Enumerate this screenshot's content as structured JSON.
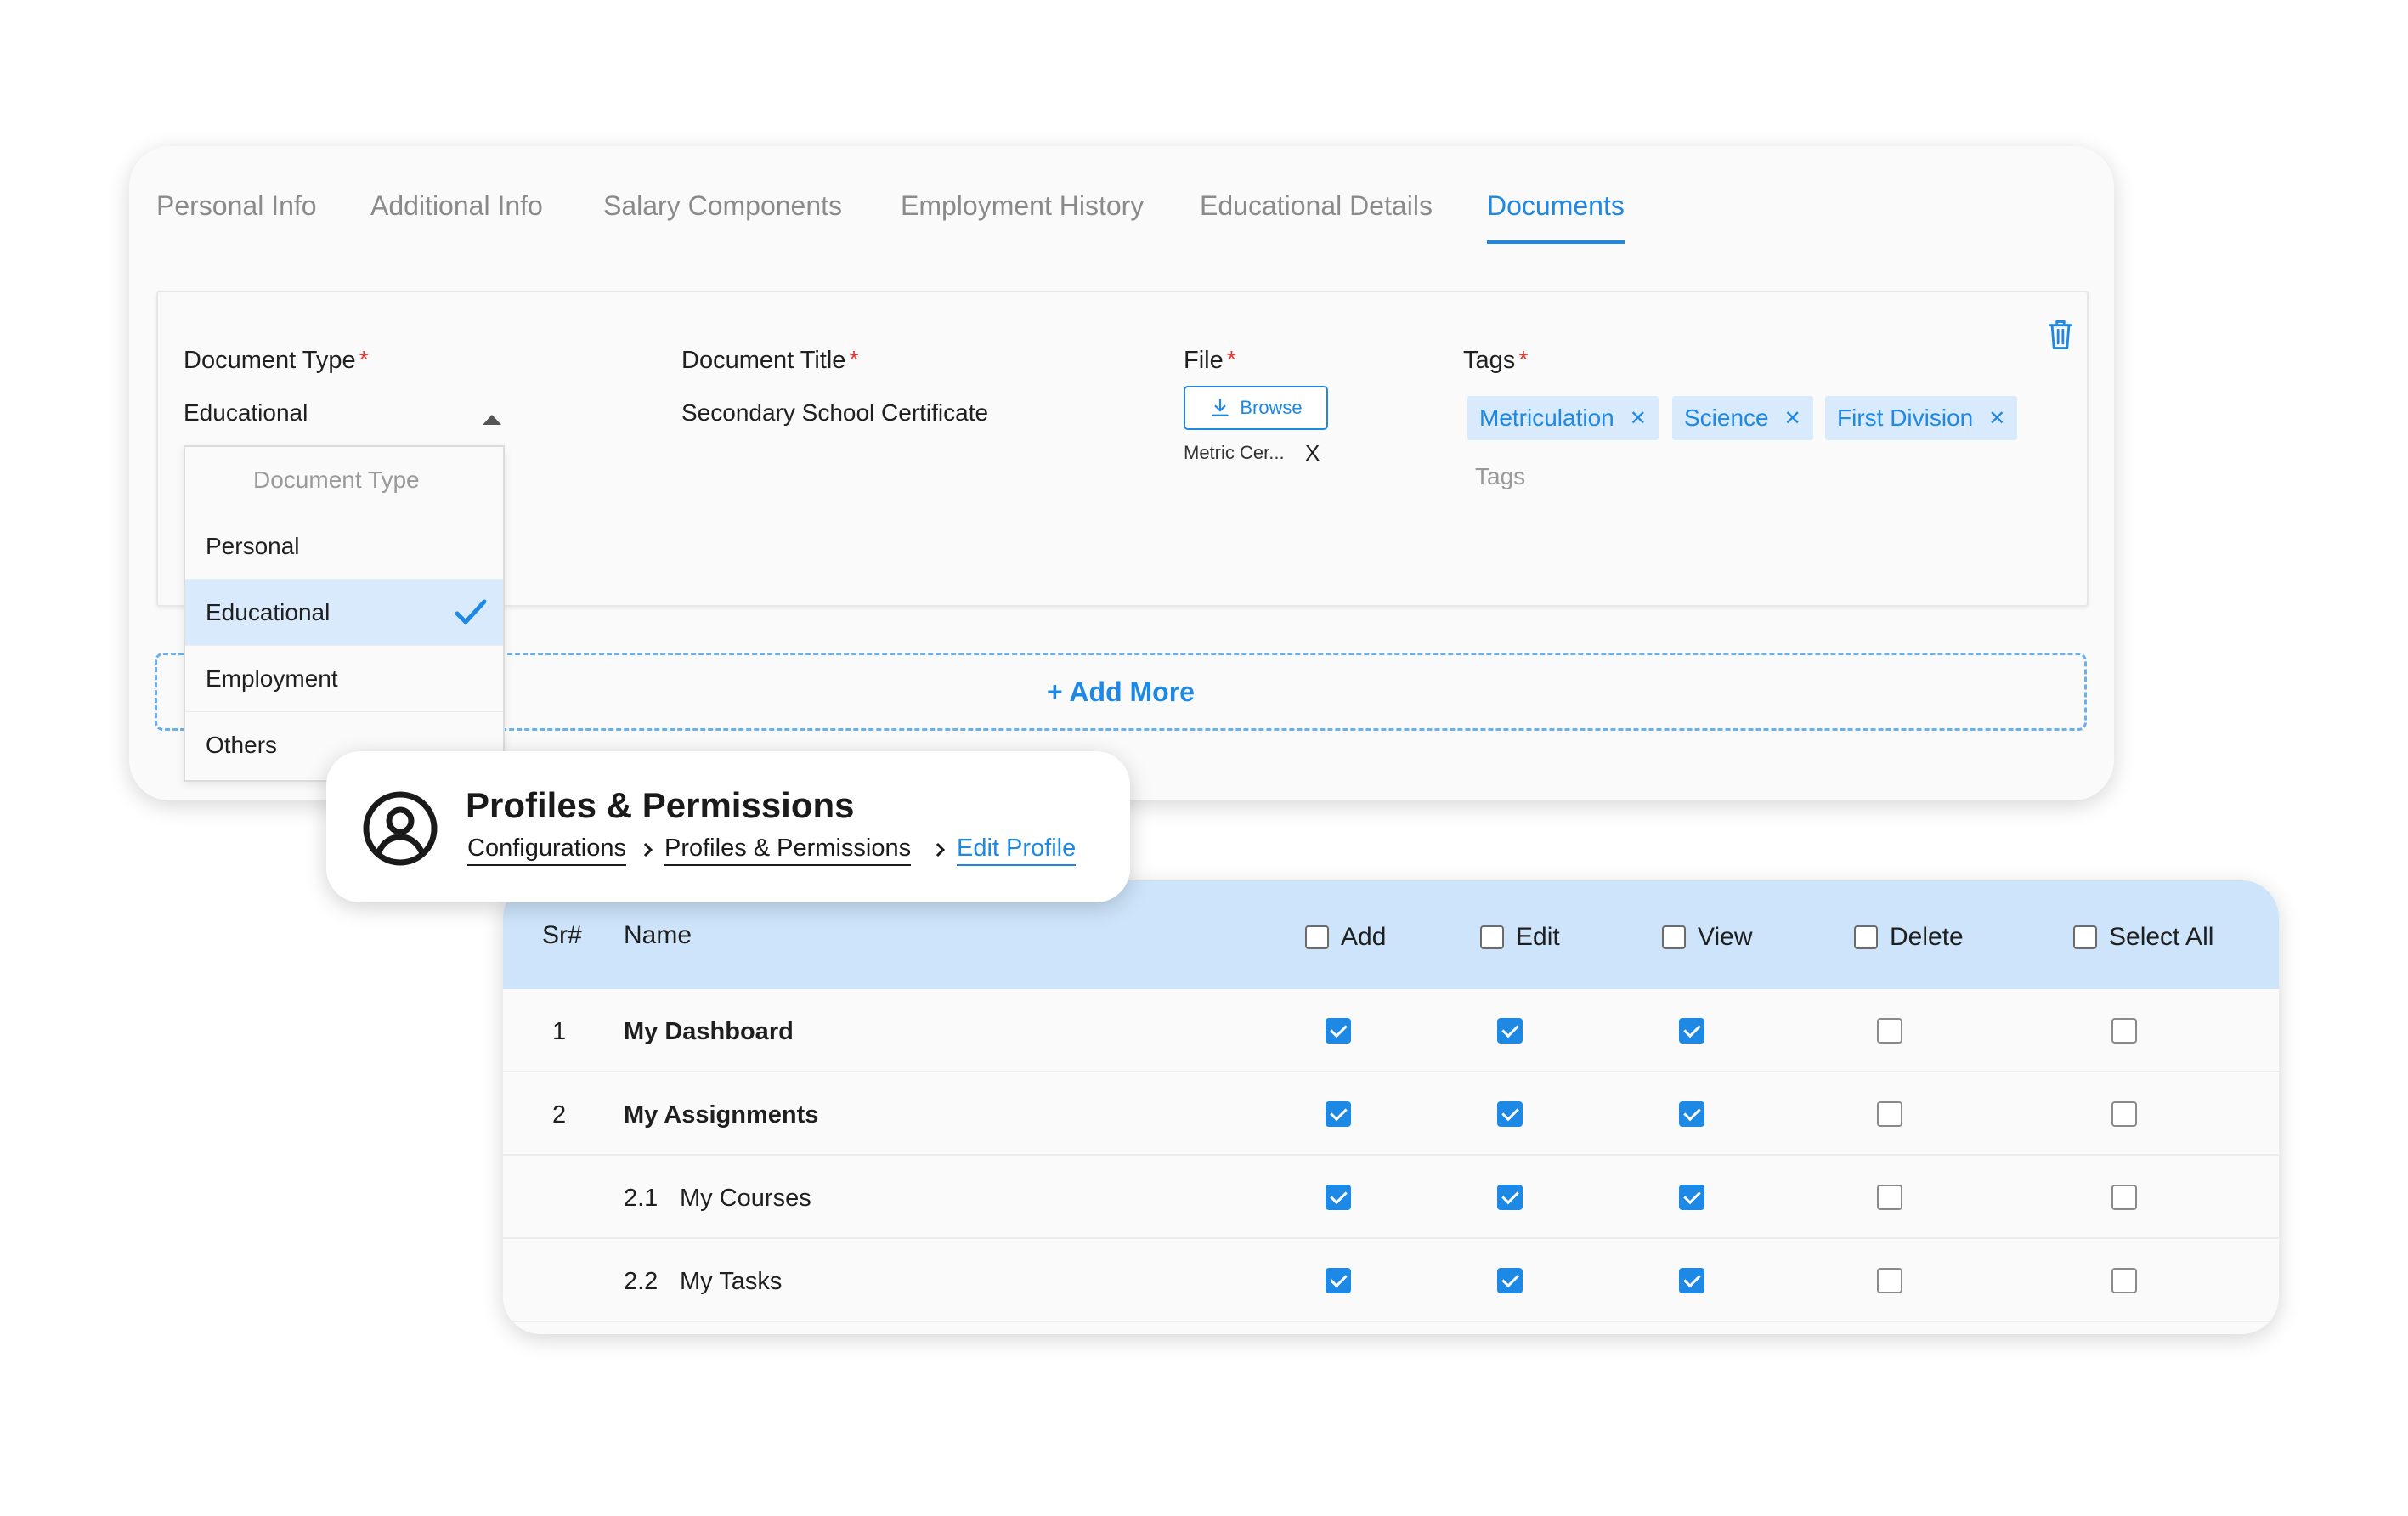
{
  "tabs": [
    {
      "label": "Personal Info"
    },
    {
      "label": "Additional Info"
    },
    {
      "label": "Salary Components"
    },
    {
      "label": "Employment History"
    },
    {
      "label": "Educational Details"
    },
    {
      "label": "Documents",
      "active": true
    }
  ],
  "document": {
    "type_label": "Document Type",
    "type_value": "Educational",
    "title_label": "Document Title",
    "title_value": "Secondary School Certificate",
    "file_label": "File",
    "browse_label": "Browse",
    "file_name": "Metric Cer...",
    "file_remove": "X",
    "tags_label": "Tags",
    "tags": [
      "Metriculation",
      "Science",
      "First Division"
    ],
    "tags_placeholder": "Tags",
    "required_mark": "*",
    "add_more_label": "+ Add More"
  },
  "dropdown": {
    "search_placeholder": "Document Type",
    "options": [
      "Personal",
      "Educational",
      "Employment",
      "Others"
    ],
    "selected": "Educational"
  },
  "profile": {
    "title": "Profiles & Permissions",
    "breadcrumb": [
      "Configurations",
      "Profiles & Permissions",
      "Edit Profile"
    ]
  },
  "permissions": {
    "headers": {
      "sr": "Sr#",
      "name": "Name",
      "add": "Add",
      "edit": "Edit",
      "view": "View",
      "delete": "Delete",
      "select_all": "Select All"
    },
    "rows": [
      {
        "sr": "1",
        "name": "My Dashboard",
        "bold": true,
        "add": true,
        "edit": true,
        "view": true,
        "delete": false,
        "all": false
      },
      {
        "sr": "2",
        "name": "My Assignments",
        "bold": true,
        "add": true,
        "edit": true,
        "view": true,
        "delete": false,
        "all": false
      },
      {
        "sr": "2.1",
        "name": "My Courses",
        "bold": false,
        "add": true,
        "edit": true,
        "view": true,
        "delete": false,
        "all": false
      },
      {
        "sr": "2.2",
        "name": "My Tasks",
        "bold": false,
        "add": true,
        "edit": true,
        "view": true,
        "delete": false,
        "all": false
      }
    ]
  },
  "colors": {
    "accent": "#1e88e5",
    "chip_bg": "#d8eafb",
    "table_header": "#cde4fa",
    "required": "#e53935"
  }
}
